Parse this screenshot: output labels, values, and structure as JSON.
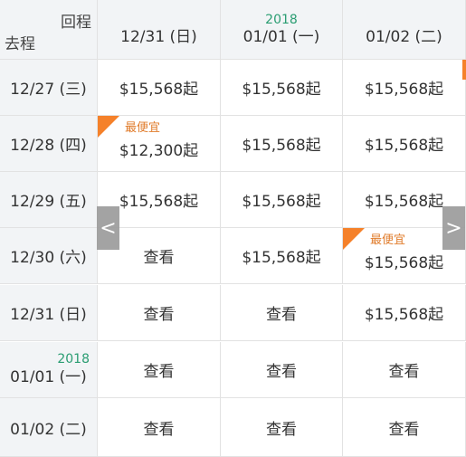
{
  "corner": {
    "return_label": "回程",
    "depart_label": "去程"
  },
  "columns": [
    {
      "date": "12/31 (日)",
      "year": ""
    },
    {
      "date": "01/01 (一)",
      "year": "2018"
    },
    {
      "date": "01/02 (二)",
      "year": ""
    }
  ],
  "rows": [
    {
      "date": "12/27 (三)",
      "year": "",
      "cells": [
        {
          "text": "$15,568起",
          "cheapest": false
        },
        {
          "text": "$15,568起",
          "cheapest": false
        },
        {
          "text": "$15,568起",
          "cheapest": false
        }
      ]
    },
    {
      "date": "12/28 (四)",
      "year": "",
      "cells": [
        {
          "text": "$12,300起",
          "cheapest": true
        },
        {
          "text": "$15,568起",
          "cheapest": false
        },
        {
          "text": "$15,568起",
          "cheapest": false
        }
      ]
    },
    {
      "date": "12/29 (五)",
      "year": "",
      "cells": [
        {
          "text": "$15,568起",
          "cheapest": false
        },
        {
          "text": "$15,568起",
          "cheapest": false
        },
        {
          "text": "$15,568起",
          "cheapest": false
        }
      ]
    },
    {
      "date": "12/30 (六)",
      "year": "",
      "cells": [
        {
          "text": "查看",
          "cheapest": false
        },
        {
          "text": "$15,568起",
          "cheapest": false
        },
        {
          "text": "$15,568起",
          "cheapest": true
        }
      ]
    },
    {
      "date": "12/31 (日)",
      "year": "",
      "cells": [
        {
          "text": "查看",
          "cheapest": false
        },
        {
          "text": "查看",
          "cheapest": false
        },
        {
          "text": "$15,568起",
          "cheapest": false
        }
      ]
    },
    {
      "date": "01/01 (一)",
      "year": "2018",
      "cells": [
        {
          "text": "查看",
          "cheapest": false
        },
        {
          "text": "查看",
          "cheapest": false
        },
        {
          "text": "查看",
          "cheapest": false
        }
      ]
    },
    {
      "date": "01/02 (二)",
      "year": "",
      "cells": [
        {
          "text": "查看",
          "cheapest": false
        },
        {
          "text": "查看",
          "cheapest": false
        },
        {
          "text": "查看",
          "cheapest": false
        }
      ]
    }
  ],
  "cheapest_label": "最便宜",
  "nav": {
    "prev": "<",
    "next": ">"
  },
  "colors": {
    "accent": "#f5812a",
    "year": "#2a9d72",
    "header_bg": "#f2f4f6"
  }
}
